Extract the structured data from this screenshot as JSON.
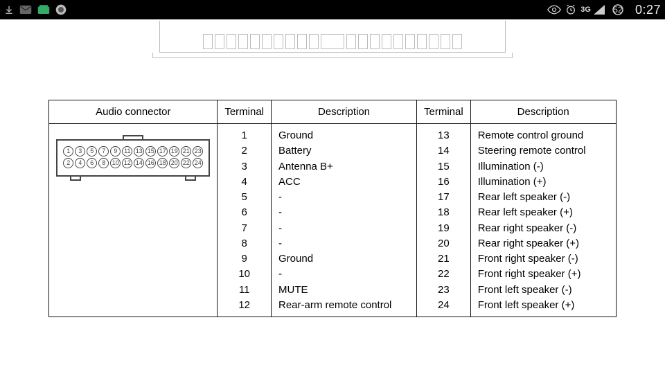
{
  "statusbar": {
    "network_label": "3G",
    "battery_pct": "52",
    "clock": "0:27"
  },
  "headers": {
    "audio_connector": "Audio connector",
    "terminal_a": "Terminal",
    "description_a": "Description",
    "terminal_b": "Terminal",
    "description_b": "Description"
  },
  "rows_a": [
    {
      "term": "1",
      "desc": "Ground"
    },
    {
      "term": "2",
      "desc": "Battery"
    },
    {
      "term": "3",
      "desc": "Antenna B+"
    },
    {
      "term": "4",
      "desc": "ACC"
    },
    {
      "term": "5",
      "desc": "-"
    },
    {
      "term": "6",
      "desc": "-"
    },
    {
      "term": "7",
      "desc": "-"
    },
    {
      "term": "8",
      "desc": "-"
    },
    {
      "term": "9",
      "desc": "Ground"
    },
    {
      "term": "10",
      "desc": "-"
    },
    {
      "term": "11",
      "desc": "MUTE"
    },
    {
      "term": "12",
      "desc": "Rear-arm remote control"
    }
  ],
  "rows_b": [
    {
      "term": "13",
      "desc": "Remote control ground"
    },
    {
      "term": "14",
      "desc": "Steering remote control"
    },
    {
      "term": "15",
      "desc": "Illumination (-)"
    },
    {
      "term": "16",
      "desc": "Illumination (+)"
    },
    {
      "term": "17",
      "desc": "Rear left speaker (-)"
    },
    {
      "term": "18",
      "desc": "Rear left speaker (+)"
    },
    {
      "term": "19",
      "desc": "Rear right speaker (-)"
    },
    {
      "term": "20",
      "desc": "Rear right speaker (+)"
    },
    {
      "term": "21",
      "desc": "Front right speaker (-)"
    },
    {
      "term": "22",
      "desc": "Front right speaker (+)"
    },
    {
      "term": "23",
      "desc": "Front left speaker (-)"
    },
    {
      "term": "24",
      "desc": "Front left speaker (+)"
    }
  ],
  "connector": {
    "pin_count": 24,
    "cols": 12
  },
  "chart_data": {
    "type": "table",
    "title": "Audio connector pinout",
    "columns": [
      "Terminal",
      "Description"
    ],
    "rows": [
      [
        1,
        "Ground"
      ],
      [
        2,
        "Battery"
      ],
      [
        3,
        "Antenna B+"
      ],
      [
        4,
        "ACC"
      ],
      [
        5,
        "-"
      ],
      [
        6,
        "-"
      ],
      [
        7,
        "-"
      ],
      [
        8,
        "-"
      ],
      [
        9,
        "Ground"
      ],
      [
        10,
        "-"
      ],
      [
        11,
        "MUTE"
      ],
      [
        12,
        "Rear-arm remote control"
      ],
      [
        13,
        "Remote control ground"
      ],
      [
        14,
        "Steering remote control"
      ],
      [
        15,
        "Illumination (-)"
      ],
      [
        16,
        "Illumination (+)"
      ],
      [
        17,
        "Rear left speaker (-)"
      ],
      [
        18,
        "Rear left speaker (+)"
      ],
      [
        19,
        "Rear right speaker (-)"
      ],
      [
        20,
        "Rear right speaker (+)"
      ],
      [
        21,
        "Front right speaker (-)"
      ],
      [
        22,
        "Front right speaker (+)"
      ],
      [
        23,
        "Front left speaker (-)"
      ],
      [
        24,
        "Front left speaker (+)"
      ]
    ]
  }
}
